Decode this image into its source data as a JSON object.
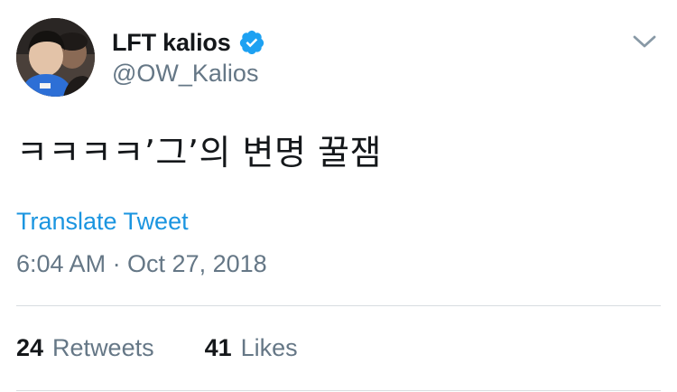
{
  "user": {
    "display_name": "LFT kalios",
    "handle": "@OW_Kalios",
    "verified": true
  },
  "tweet": {
    "text": "ㅋㅋㅋㅋ’그’의 변명 꿀잼",
    "translate_label": "Translate Tweet",
    "timestamp": "6:04 AM · Oct 27, 2018"
  },
  "stats": {
    "retweets_count": "24",
    "retweets_label": "Retweets",
    "likes_count": "41",
    "likes_label": "Likes"
  },
  "icons": {
    "verified": "verified-badge-icon",
    "menu": "chevron-down-icon"
  },
  "colors": {
    "accent": "#1b95e0",
    "verified": "#1da1f2",
    "secondary_text": "#657786",
    "divider": "#d8dde1"
  }
}
